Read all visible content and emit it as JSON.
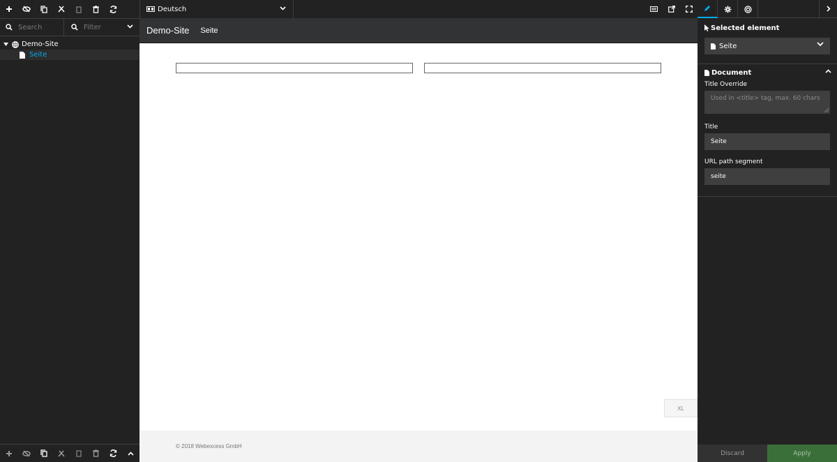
{
  "tree_panel": {
    "search_placeholder": "Search",
    "filter_placeholder": "Filter",
    "root_label": "Demo-Site",
    "child_label": "Seite"
  },
  "topbar": {
    "dimension_label": "Deutsch"
  },
  "canvas": {
    "site_name": "Demo-Site",
    "nav_item": "Seite",
    "breakpoint": "XL",
    "footer_text": "© 2018 Webexcess GmbH"
  },
  "inspector": {
    "selected_element_heading": "Selected element",
    "selected_element_value": "Seite",
    "group_title": "Document",
    "title_override_label": "Title Override",
    "title_override_placeholder": "Used in <title> tag, max. 60 chars",
    "title_label": "Title",
    "title_value": "Seite",
    "url_label": "URL path segment",
    "url_value": "seite",
    "discard_label": "Discard",
    "apply_label": "Apply"
  },
  "colors": {
    "accent": "#00adee",
    "apply": "#3b6f3a",
    "panel": "#222222"
  }
}
